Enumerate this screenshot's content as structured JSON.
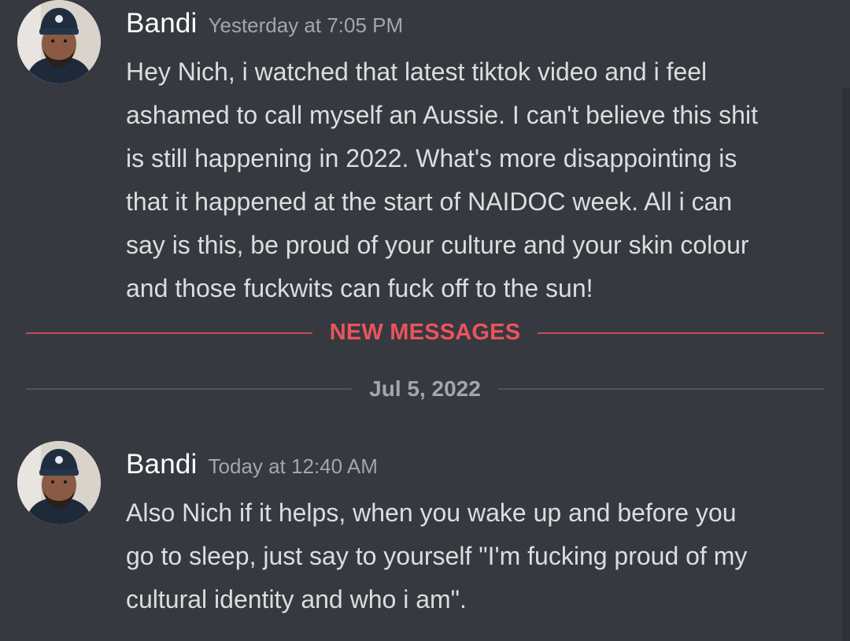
{
  "messages": [
    {
      "author": "Bandi",
      "timestamp": "Yesterday at 7:05 PM",
      "lines": [
        "Hey Nich, i watched that latest tiktok video and i feel",
        "ashamed to call myself an Aussie. I can't believe this shit",
        "is still happening in 2022. What's more disappointing is",
        "that it happened at the start of NAIDOC week. All i can",
        "say is this, be proud of your culture and your skin colour",
        "and those fuckwits can fuck off  to the sun!"
      ]
    },
    {
      "author": "Bandi",
      "timestamp": "Today at 12:40 AM",
      "lines": [
        "Also Nich if it helps, when you wake up and before you",
        "go to sleep, just say to yourself \"I'm fucking proud of my",
        "cultural identity and who i am\"."
      ]
    }
  ],
  "dividers": {
    "new_messages": "NEW MESSAGES",
    "date": "Jul 5, 2022"
  },
  "colors": {
    "background": "#36393f",
    "text": "#dcddde",
    "username": "#ffffff",
    "timestamp": "#a3a6aa",
    "new_messages_accent": "#e9555b"
  },
  "icons": {
    "avatar": "user-avatar-photo"
  }
}
